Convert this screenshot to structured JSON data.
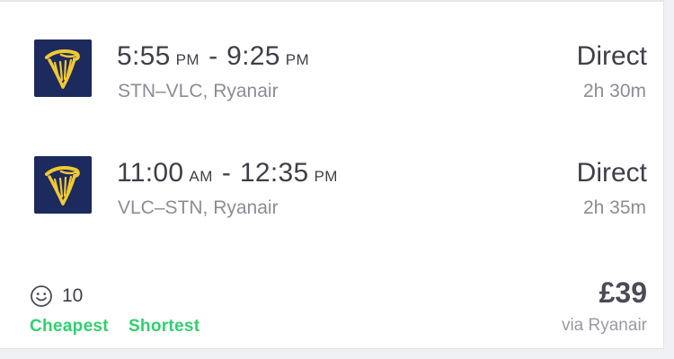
{
  "flights": [
    {
      "depart_time": "5:55",
      "depart_ampm": "PM",
      "arrive_time": "9:25",
      "arrive_ampm": "PM",
      "route": "STN–VLC, Ryanair",
      "stops": "Direct",
      "duration": "2h 30m",
      "airline_logo_icon": "ryanair-harp-logo"
    },
    {
      "depart_time": "11:00",
      "depart_ampm": "AM",
      "arrive_time": "12:35",
      "arrive_ampm": "PM",
      "route": "VLC–STN, Ryanair",
      "stops": "Direct",
      "duration": "2h 35m",
      "airline_logo_icon": "ryanair-harp-logo"
    }
  ],
  "time_separator": "-",
  "score": {
    "icon": "smiley-icon",
    "value": "10"
  },
  "badges": [
    "Cheapest",
    "Shortest"
  ],
  "price": {
    "amount": "£39",
    "via": "via Ryanair"
  },
  "colors": {
    "logo_background": "#1c2a5d",
    "logo_harp": "#f1c932",
    "badge": "#2ed16d",
    "primary_text": "#3f3f4a",
    "secondary_text": "#8b8c96"
  }
}
